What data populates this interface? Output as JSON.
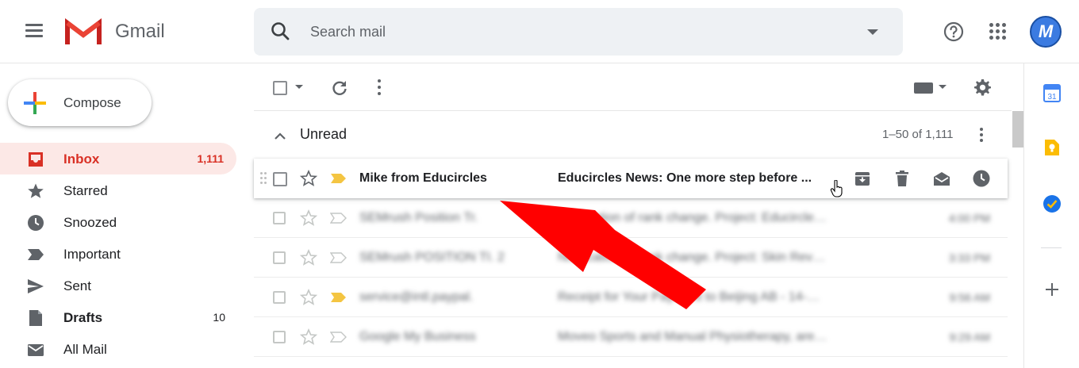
{
  "app": {
    "name": "Gmail"
  },
  "search": {
    "placeholder": "Search mail"
  },
  "user": {
    "avatar_letter": "M"
  },
  "compose": {
    "label": "Compose"
  },
  "sidebar": {
    "items": [
      {
        "label": "Inbox",
        "count": "1,111",
        "icon": "inbox-icon",
        "active": true
      },
      {
        "label": "Starred",
        "count": "",
        "icon": "star-icon"
      },
      {
        "label": "Snoozed",
        "count": "",
        "icon": "clock-icon"
      },
      {
        "label": "Important",
        "count": "",
        "icon": "important-icon"
      },
      {
        "label": "Sent",
        "count": "",
        "icon": "send-icon"
      },
      {
        "label": "Drafts",
        "count": "10",
        "icon": "draft-icon"
      },
      {
        "label": "All Mail",
        "count": "",
        "icon": "mail-icon"
      }
    ]
  },
  "section": {
    "title": "Unread",
    "range": "1–50 of 1,111"
  },
  "emails": [
    {
      "sender": "Mike from Educircles",
      "subject": "Educircles News: One more step before ...",
      "time": "",
      "important": true,
      "hover": true
    },
    {
      "sender": "SEMrush Position Tr.",
      "subject": "Notification of rank change. Project: Educircles.org...",
      "time": "4:00 PM",
      "important": false
    },
    {
      "sender": "SEMrush POSITION TI. 2",
      "subject": "Notification of rank change. Project: Skin Revival - P...",
      "time": "3:33 PM",
      "important": false
    },
    {
      "sender": "service@intl.paypal.",
      "subject": "Receipt for Your Payment to Beijing AB - 14-Dec-20...",
      "time": "9:56 AM",
      "important": true
    },
    {
      "sender": "Google My Business",
      "subject": "Moveo Sports and Manual Physiotherapy, are you s...",
      "time": "9:29 AM",
      "important": false
    }
  ],
  "colors": {
    "brand_red": "#d93025",
    "active_bg": "#fce8e6",
    "important_yellow": "#f4c542",
    "annotation_arrow": "#ff0000",
    "avatar_blue": "#3b7be1"
  }
}
